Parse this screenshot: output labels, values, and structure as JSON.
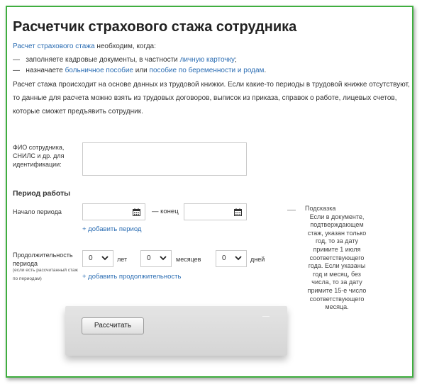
{
  "title": "Расчетчик страхового стажа сотрудника",
  "intro": {
    "link": "Расчет страхового стажа",
    "rest": " необходим, когда:"
  },
  "bullets": [
    {
      "dash": "—",
      "text": "заполняете кадровые документы, в частности ",
      "link": "личную карточку",
      "tail": ";"
    },
    {
      "dash": "—",
      "text": "назначаете ",
      "link": "больничное пособие",
      "mid": " или ",
      "link2": "пособие по беременности и родам",
      "tail": "."
    }
  ],
  "paragraph": "Расчет стажа происходит на основе данных из трудовой книжки. Если какие-то периоды в трудовой книжке отсутствуют, то данные для расчета можно взять из трудовых договоров, выписок из приказа, справок о работе, лицевых счетов, которые сможет предъявить сотрудник.",
  "form": {
    "fio_label": "ФИО сотрудника, СНИЛС и др. для идентификации:",
    "fio_value": "",
    "period_heading": "Период работы",
    "start_label": "Начало периода",
    "start_value": "",
    "end_label": "— конец",
    "end_value": "",
    "add_period": "+ добавить период",
    "duration_label": "Продолжительность периода",
    "duration_note": "(если есть рассчитанный стаж по периодам)",
    "years": {
      "value": "0",
      "unit": "лет"
    },
    "months": {
      "value": "0",
      "unit": "месяцев"
    },
    "days": {
      "value": "0",
      "unit": "дней"
    },
    "add_duration": "+ добавить продолжительность",
    "calculate": "Рассчитать"
  },
  "hint": {
    "title": "Подсказка",
    "text": "Если в документе, подтверждающем стаж, указан только год, то за дату примите 1 июля соответствующего года. Если указаны год и месяц, без числа, то за дату примите 15-е число соответствующего месяца."
  },
  "colors": {
    "frame_border": "#3fae3f",
    "link": "#2b6db3"
  },
  "icons": {
    "calendar": "calendar-icon",
    "dropdown": "chevron-down-icon"
  }
}
